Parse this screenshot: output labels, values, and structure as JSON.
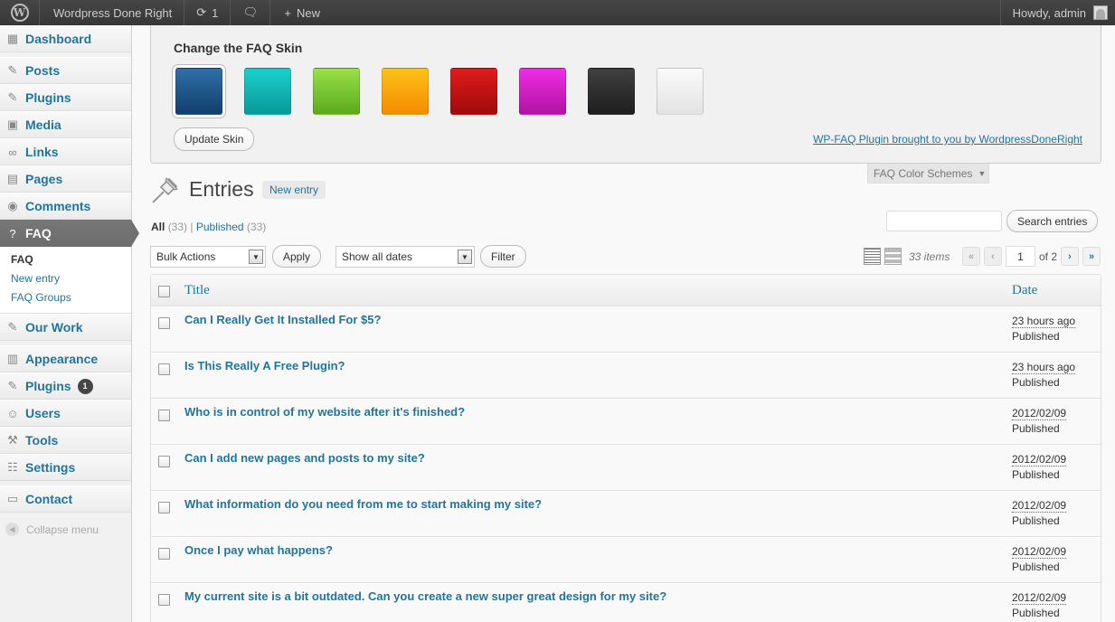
{
  "adminbar": {
    "site_name": "Wordpress Done Right",
    "updates_count": "1",
    "new_label": "New",
    "howdy": "Howdy, admin"
  },
  "menu": {
    "items": [
      {
        "label": "Dashboard",
        "icon": "dashboard-icon"
      },
      {
        "label": "Posts",
        "icon": "pushpin-icon"
      },
      {
        "label": "Plugins",
        "icon": "pushpin-icon"
      },
      {
        "label": "Media",
        "icon": "media-icon"
      },
      {
        "label": "Links",
        "icon": "link-icon"
      },
      {
        "label": "Pages",
        "icon": "page-icon"
      },
      {
        "label": "Comments",
        "icon": "comment-icon"
      },
      {
        "label": "FAQ",
        "icon": "question-icon"
      },
      {
        "label": "Our Work",
        "icon": "pushpin-icon"
      },
      {
        "label": "Appearance",
        "icon": "appearance-icon"
      },
      {
        "label": "Plugins",
        "icon": "plugin-icon",
        "badge": "1"
      },
      {
        "label": "Users",
        "icon": "users-icon"
      },
      {
        "label": "Tools",
        "icon": "tools-icon"
      },
      {
        "label": "Settings",
        "icon": "settings-icon"
      },
      {
        "label": "Contact",
        "icon": "contact-icon"
      }
    ],
    "faq_submenu": [
      "FAQ",
      "New entry",
      "FAQ Groups"
    ],
    "collapse": "Collapse menu"
  },
  "skin_panel": {
    "heading": "Change the FAQ Skin",
    "swatches": [
      {
        "name": "blue",
        "top": "#2f6fa8",
        "bottom": "#123f6c"
      },
      {
        "name": "teal",
        "top": "#1ccfcc",
        "bottom": "#089a99"
      },
      {
        "name": "green",
        "top": "#9ae04a",
        "bottom": "#5aaa1d"
      },
      {
        "name": "orange",
        "top": "#ffc21a",
        "bottom": "#f38b00"
      },
      {
        "name": "red",
        "top": "#e01c1c",
        "bottom": "#9e0b0b"
      },
      {
        "name": "magenta",
        "top": "#ee2ee6",
        "bottom": "#b1139f"
      },
      {
        "name": "black",
        "top": "#404040",
        "bottom": "#1e1e1e"
      },
      {
        "name": "white",
        "top": "#fafafa",
        "bottom": "#e3e3e3"
      }
    ],
    "update_button": "Update Skin",
    "credit_link": "WP-FAQ Plugin brought to you by WordpressDoneRight",
    "tab_label": "FAQ Color Schemes"
  },
  "page": {
    "title": "Entries",
    "new_entry": "New entry",
    "filters": {
      "all_label": "All",
      "all_count": "(33)",
      "separator": "|",
      "published_label": "Published",
      "published_count": "(33)"
    },
    "search_button": "Search entries",
    "bulk_actions": "Bulk Actions",
    "apply": "Apply",
    "date_filter": "Show all dates",
    "filter": "Filter",
    "items_count": "33 items",
    "current_page": "1",
    "of_pages": "of 2"
  },
  "table": {
    "columns": [
      "Title",
      "Date"
    ],
    "rows": [
      {
        "title": "Can I Really Get It Installed For $5?",
        "date": "23 hours ago",
        "status": "Published"
      },
      {
        "title": "Is This Really A Free Plugin?",
        "date": "23 hours ago",
        "status": "Published"
      },
      {
        "title": "Who is in control of my website after it's finished?",
        "date": "2012/02/09",
        "status": "Published"
      },
      {
        "title": "Can I add new pages and posts to my site?",
        "date": "2012/02/09",
        "status": "Published"
      },
      {
        "title": "What information do you need from me to start making my site?",
        "date": "2012/02/09",
        "status": "Published"
      },
      {
        "title": "Once I pay what happens?",
        "date": "2012/02/09",
        "status": "Published"
      },
      {
        "title": "My current site is a bit outdated. Can you create a new super great design for my site?",
        "date": "2012/02/09",
        "status": "Published"
      }
    ]
  },
  "colors": {
    "link": "#21759b",
    "menu_current": "#707070",
    "adminbar": "#464646"
  }
}
